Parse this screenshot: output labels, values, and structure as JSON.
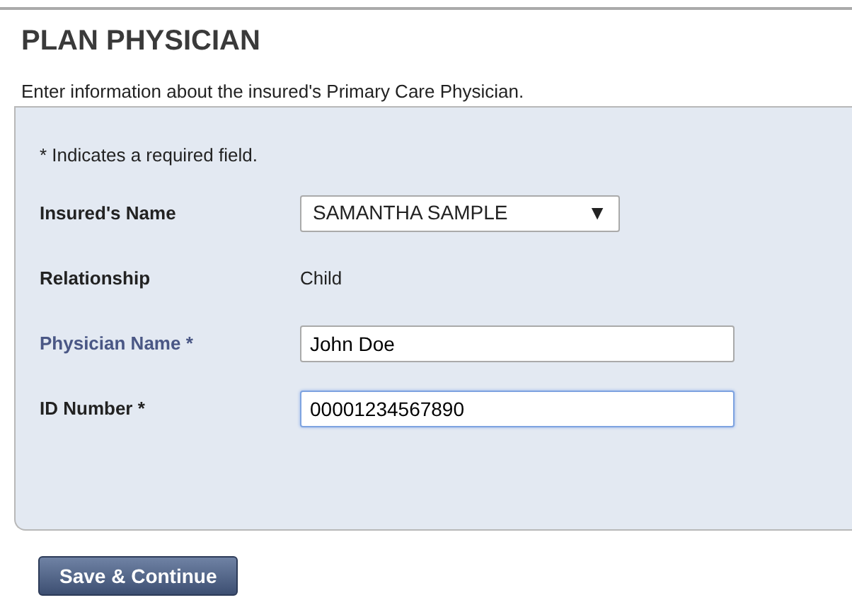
{
  "title": "PLAN PHYSICIAN",
  "subtitle": "Enter information about the insured's Primary Care Physician.",
  "note": "* Indicates a required field.",
  "rows": [
    {
      "kind": "select",
      "label": "Insured's Name",
      "value": "SAMANTHA SAMPLE",
      "caret": "▼",
      "highlighted": false
    },
    {
      "kind": "static",
      "label": "Relationship",
      "value": "Child",
      "highlighted": false
    },
    {
      "kind": "input",
      "label": "Physician Name *",
      "value": "John Doe",
      "highlighted": true,
      "focused": false
    },
    {
      "kind": "input",
      "label": "ID Number *",
      "value": "00001234567890",
      "highlighted": false,
      "focused": true
    }
  ],
  "button": "Save & Continue"
}
